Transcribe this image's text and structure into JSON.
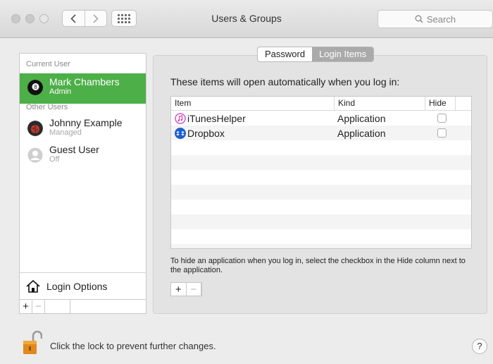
{
  "window": {
    "title": "Users & Groups"
  },
  "toolbar": {
    "back_icon": "chevron-left-icon",
    "forward_icon": "chevron-right-icon",
    "grid_icon": "show-all-grid-icon",
    "search_placeholder": "Search"
  },
  "sidebar": {
    "current_header": "Current User",
    "other_header": "Other Users",
    "users": [
      {
        "name": "Mark Chambers",
        "role": "Admin",
        "selected": true
      },
      {
        "name": "Johnny Example",
        "role": "Managed"
      },
      {
        "name": "Guest User",
        "role": "Off"
      }
    ],
    "login_options_label": "Login Options",
    "add_label": "+",
    "remove_label": "−"
  },
  "tabs": [
    {
      "label": "Password",
      "active": false
    },
    {
      "label": "Login Items",
      "active": true
    }
  ],
  "login_items": {
    "intro": "These items will open automatically when you log in:",
    "columns": [
      "Item",
      "Kind",
      "Hide"
    ],
    "rows": [
      {
        "name": "iTunesHelper",
        "kind": "Application",
        "icon": "itunes-icon",
        "hide": false
      },
      {
        "name": "Dropbox",
        "kind": "Application",
        "icon": "dropbox-icon",
        "hide": false
      }
    ],
    "hint": "To hide an application when you log in, select the checkbox in the Hide column next to the application.",
    "add_label": "+",
    "remove_label": "−"
  },
  "footer": {
    "lock_text": "Click the lock to prevent further changes.",
    "help_label": "?"
  },
  "colors": {
    "selection": "#4daf48",
    "active_tab": "#aaaaaa"
  }
}
